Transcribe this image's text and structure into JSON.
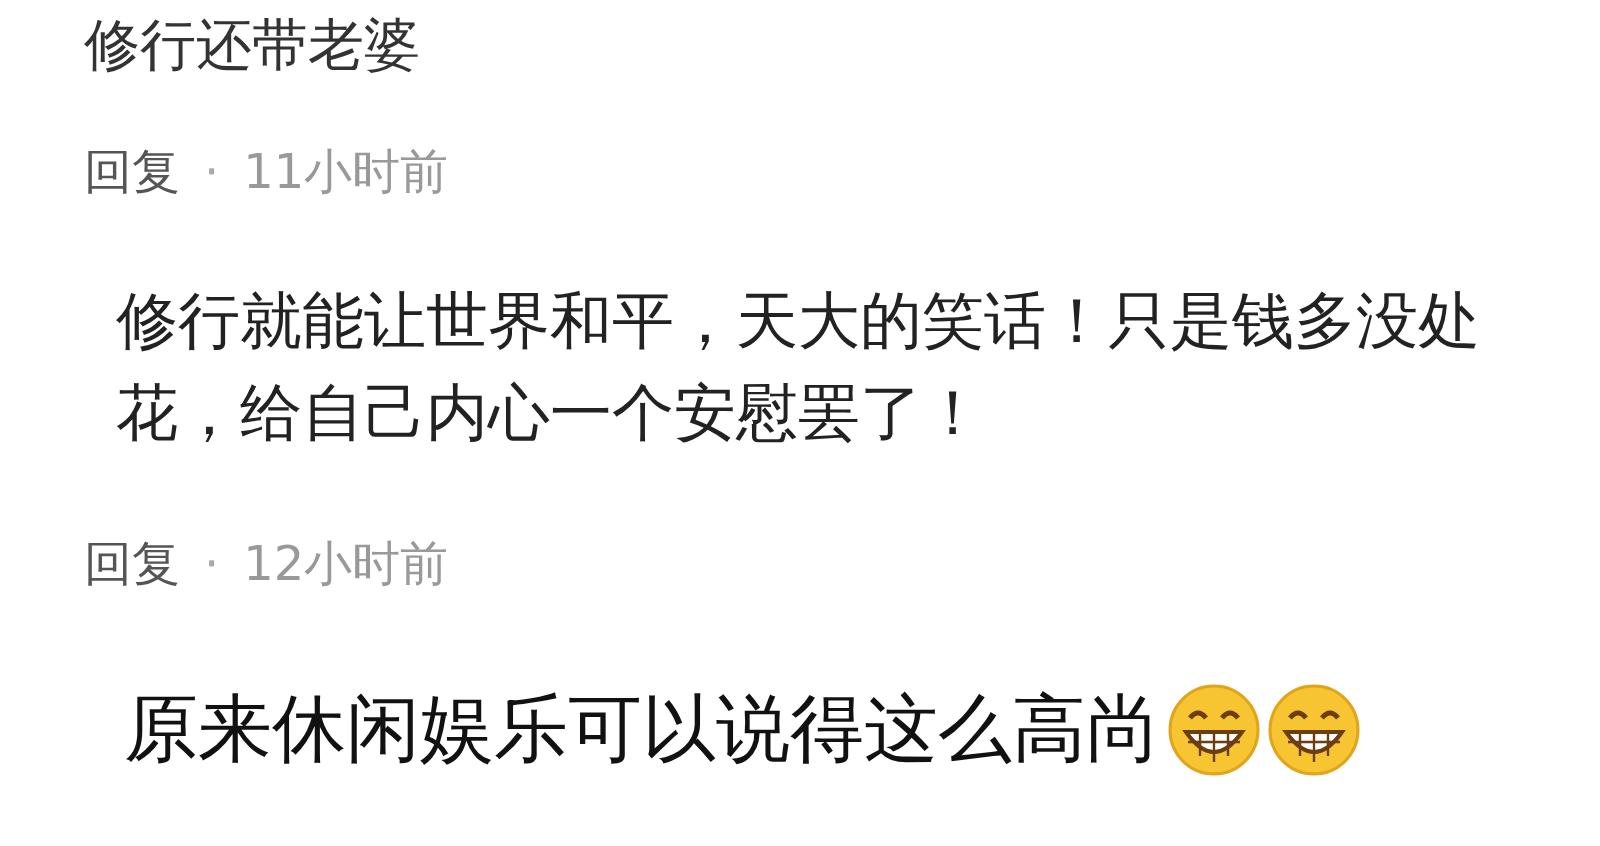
{
  "comments": [
    {
      "text": "修行还带老婆",
      "reply": "回复",
      "separator": "·",
      "time": "11小时前"
    },
    {
      "text": "修行就能让世界和平，天大的笑话！只是钱多没处花，给自己内心一个安慰罢了！",
      "reply": "回复",
      "separator": "·",
      "time": "12小时前"
    },
    {
      "text": "原来休闲娱乐可以说得这么高尚",
      "emojis": [
        {
          "kind": "grin"
        },
        {
          "kind": "grin"
        }
      ]
    }
  ]
}
